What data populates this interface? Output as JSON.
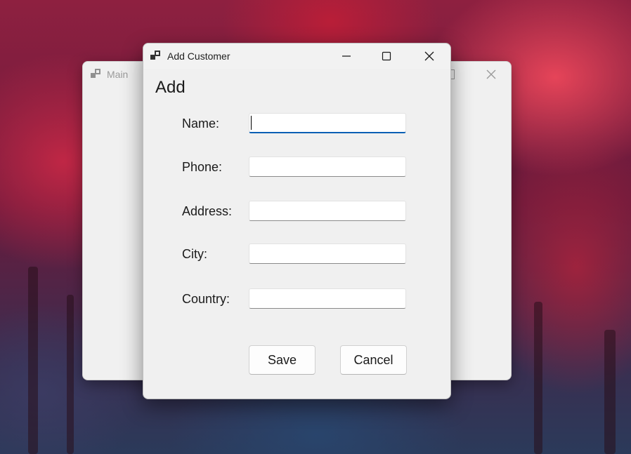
{
  "main_window": {
    "title": "Main",
    "icon": "app-window-icon"
  },
  "dialog": {
    "title": "Add Customer",
    "icon": "app-window-icon",
    "heading": "Add",
    "caption_buttons": [
      "minimize-icon",
      "maximize-icon",
      "close-icon"
    ],
    "fields": [
      {
        "label": "Name:",
        "value": "",
        "placeholder": ""
      },
      {
        "label": "Phone:",
        "value": "",
        "placeholder": ""
      },
      {
        "label": "Address:",
        "value": "",
        "placeholder": ""
      },
      {
        "label": "City:",
        "value": "",
        "placeholder": ""
      },
      {
        "label": "Country:",
        "value": "",
        "placeholder": ""
      }
    ],
    "buttons": {
      "save": "Save",
      "cancel": "Cancel"
    }
  },
  "colors": {
    "focus_accent": "#0a5fb4",
    "window_bg": "#f0f0f0"
  }
}
